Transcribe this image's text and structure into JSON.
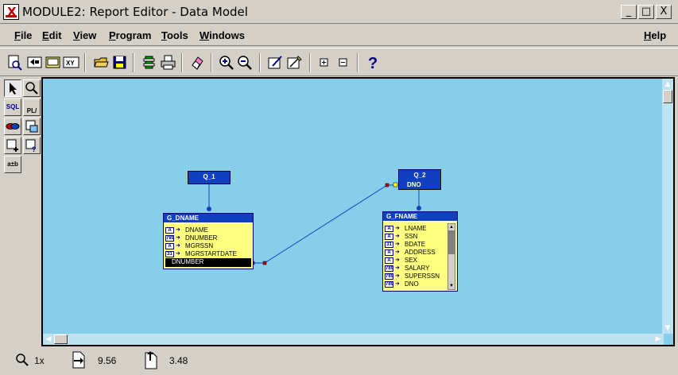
{
  "window": {
    "title": "MODULE2: Report Editor - Data Model",
    "minimize": "_",
    "maximize": "□",
    "close": "X"
  },
  "menu": {
    "file": "File",
    "edit": "Edit",
    "view": "View",
    "program": "Program",
    "tools": "Tools",
    "windows": "Windows",
    "help": "Help"
  },
  "toolbar": {
    "icons": [
      "preview-icon",
      "previous-icon",
      "next-icon",
      "xy-icon",
      "open-icon",
      "save-icon",
      "run-icon",
      "print-icon",
      "eraser-icon",
      "zoom-in-icon",
      "zoom-out-icon",
      "edit-icon",
      "pen-icon",
      "expand-icon",
      "collapse-icon",
      "help-icon"
    ],
    "xy_label": "XY",
    "help_label": "?"
  },
  "palette": {
    "sql_label": "SQL",
    "plsql_label": "PL/\nSQL",
    "ab_label": "a±b"
  },
  "canvas": {
    "queries": [
      {
        "title": "Q_1",
        "column": ""
      },
      {
        "title": "Q_2",
        "column": "DNO"
      }
    ],
    "groups": [
      {
        "title": "G_DNAME",
        "columns": [
          {
            "type": "A",
            "name": "DNAME"
          },
          {
            "type": "789",
            "name": "DNUMBER"
          },
          {
            "type": "A",
            "name": "MGRSSN"
          },
          {
            "type": "31",
            "name": "MGRSTARTDATE"
          }
        ],
        "selected": "DNUMBER"
      },
      {
        "title": "G_FNAME",
        "columns": [
          {
            "type": "A",
            "name": "LNAME"
          },
          {
            "type": "A",
            "name": "SSN"
          },
          {
            "type": "31",
            "name": "BDATE"
          },
          {
            "type": "A",
            "name": "ADDRESS"
          },
          {
            "type": "A",
            "name": "SEX"
          },
          {
            "type": "789",
            "name": "SALARY"
          },
          {
            "type": "789",
            "name": "SUPERSSN"
          },
          {
            "type": "789",
            "name": "DNO"
          }
        ]
      }
    ]
  },
  "status": {
    "zoom": "1x",
    "x_pos": "9.56",
    "y_pos": "3.48"
  },
  "colors": {
    "canvas_bg": "#87ceeb",
    "object_blue": "#1040c0",
    "group_body": "#ffff80"
  }
}
